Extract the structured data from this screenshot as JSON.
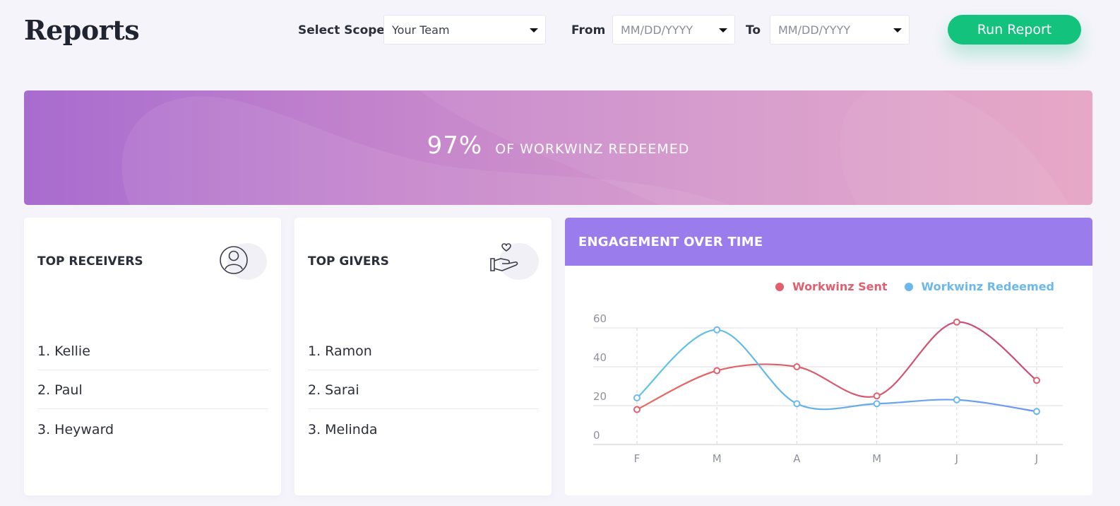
{
  "header": {
    "title": "Reports",
    "scope_label": "Select Scope",
    "scope_value": "Your Team",
    "from_label": "From",
    "from_placeholder": "MM/DD/YYYY",
    "to_label": "To",
    "to_placeholder": "MM/DD/YYYY",
    "run_button": "Run Report",
    "accent_color": "#12c27d"
  },
  "banner": {
    "percent": "97%",
    "caption": "OF WORKWINZ REDEEMED"
  },
  "top_receivers": {
    "title": "TOP RECEIVERS",
    "icon": "user-circle-icon",
    "items": [
      "1. Kellie",
      "2. Paul",
      "3. Heyward"
    ]
  },
  "top_givers": {
    "title": "TOP GIVERS",
    "icon": "heart-hand-icon",
    "items": [
      "1. Ramon",
      "2. Sarai",
      "3. Melinda"
    ]
  },
  "engagement": {
    "title": "ENGAGEMENT OVER TIME",
    "header_color": "#9a7ced"
  },
  "chart_data": {
    "type": "line",
    "categories": [
      "F",
      "M",
      "A",
      "M",
      "J",
      "J"
    ],
    "yticks": [
      0,
      20,
      40,
      60
    ],
    "ylim": [
      0,
      60
    ],
    "grid": true,
    "legend_position": "top-right",
    "series": [
      {
        "name": "Workwinz Sent",
        "values": [
          18,
          38,
          40,
          25,
          63,
          33
        ],
        "color": "#e06070"
      },
      {
        "name": "Workwinz Redeemed",
        "values": [
          24,
          59,
          21,
          21,
          23,
          17
        ],
        "color": "#6cb8ec"
      }
    ]
  }
}
